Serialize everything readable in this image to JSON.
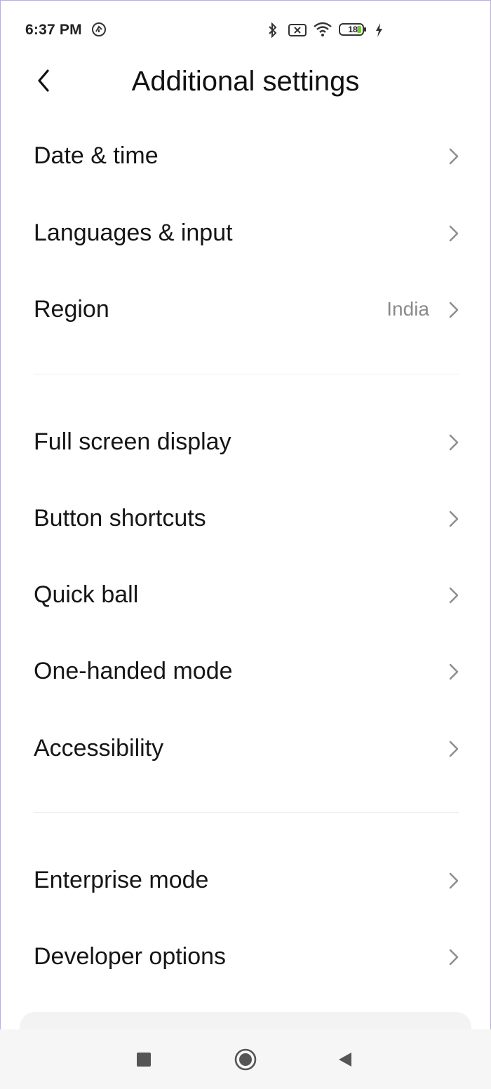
{
  "status_bar": {
    "time": "6:37 PM",
    "battery_level": "18",
    "icons": [
      "notification-icon",
      "bluetooth-icon",
      "sim-icon",
      "wifi-icon",
      "battery-icon",
      "charging-icon"
    ]
  },
  "header": {
    "title": "Additional settings",
    "back_icon": "back-chevron-icon"
  },
  "sections": [
    {
      "items": [
        {
          "label": "Date & time",
          "value": ""
        },
        {
          "label": "Languages & input",
          "value": ""
        },
        {
          "label": "Region",
          "value": "India"
        }
      ]
    },
    {
      "items": [
        {
          "label": "Full screen display",
          "value": ""
        },
        {
          "label": "Button shortcuts",
          "value": ""
        },
        {
          "label": "Quick ball",
          "value": ""
        },
        {
          "label": "One-handed mode",
          "value": ""
        },
        {
          "label": "Accessibility",
          "value": ""
        }
      ]
    },
    {
      "items": [
        {
          "label": "Enterprise mode",
          "value": ""
        },
        {
          "label": "Developer options",
          "value": ""
        }
      ]
    }
  ],
  "nav_bar": {
    "icons": [
      "recents-icon",
      "home-icon",
      "back-icon"
    ]
  },
  "colors": {
    "accent_battery": "#7cc242",
    "text_primary": "#161616",
    "text_secondary": "#8a8a8a",
    "divider": "#ededed"
  }
}
